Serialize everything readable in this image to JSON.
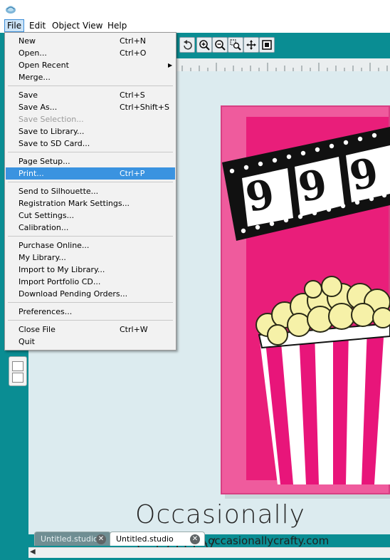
{
  "menubar": {
    "items": [
      {
        "label": "File",
        "active": true
      },
      {
        "label": "Edit"
      },
      {
        "label": "Object"
      },
      {
        "label": "View"
      },
      {
        "label": "Help"
      }
    ]
  },
  "file_menu": {
    "items": [
      {
        "label": "New",
        "shortcut": "Ctrl+N"
      },
      {
        "label": "Open...",
        "shortcut": "Ctrl+O"
      },
      {
        "label": "Open Recent",
        "submenu": true
      },
      {
        "label": "Merge..."
      },
      {
        "label": "Save",
        "shortcut": "Ctrl+S"
      },
      {
        "label": "Save As...",
        "shortcut": "Ctrl+Shift+S"
      },
      {
        "label": "Save Selection...",
        "disabled": true
      },
      {
        "label": "Save to Library..."
      },
      {
        "label": "Save to SD Card..."
      },
      {
        "label": "Page Setup..."
      },
      {
        "label": "Print...",
        "shortcut": "Ctrl+P",
        "highlighted": true
      },
      {
        "label": "Send to Silhouette..."
      },
      {
        "label": "Registration Mark Settings..."
      },
      {
        "label": "Cut Settings..."
      },
      {
        "label": "Calibration..."
      },
      {
        "label": "Purchase Online..."
      },
      {
        "label": "My Library..."
      },
      {
        "label": "Import to My Library..."
      },
      {
        "label": "Import Portfolio CD..."
      },
      {
        "label": "Download Pending Orders..."
      },
      {
        "label": "Preferences..."
      },
      {
        "label": "Close File",
        "shortcut": "Ctrl+W"
      },
      {
        "label": "Quit"
      }
    ]
  },
  "toolbar": {
    "icons": [
      "undo-icon",
      "zoom-in-icon",
      "zoom-out-icon",
      "zoom-selection-icon",
      "pan-hand-icon",
      "fit-page-icon"
    ]
  },
  "document": {
    "film_digits": [
      "9",
      "9",
      "9"
    ]
  },
  "tabs": [
    {
      "label": "Untitled.studio",
      "active": false
    },
    {
      "label": "Untitled.studio",
      "active": true
    }
  ],
  "watermark": {
    "title": "Occasionally Crafty",
    "url": "www.occasionallycrafty.com"
  },
  "colors": {
    "teal_background": "#0a8d93",
    "card_pink": "#ef5b9d",
    "card_inner": "#e91e7a",
    "menu_highlight": "#3a93e0"
  }
}
